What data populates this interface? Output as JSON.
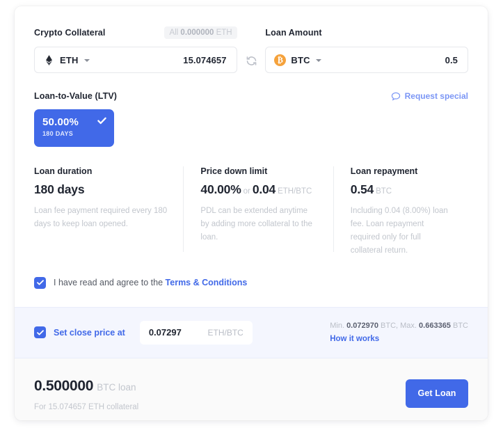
{
  "collateral": {
    "label": "Crypto Collateral",
    "all_prefix": "All",
    "all_amount": "0.000000",
    "all_unit": "ETH",
    "token": "ETH",
    "token_icon": "eth-diamond-icon",
    "amount": "15.074657"
  },
  "swap": {
    "icon": "swap-refresh-icon"
  },
  "loan_amount": {
    "label": "Loan Amount",
    "token": "BTC",
    "token_icon": "btc-circle-icon",
    "amount": "0.5"
  },
  "ltv": {
    "label": "Loan-to-Value (LTV)",
    "request_special": "Request special",
    "request_icon": "speech-bubble-icon",
    "selected": {
      "percent": "50.00%",
      "term": "180 DAYS",
      "check_icon": "check-icon"
    },
    "accent_color": "#4169e8"
  },
  "info": [
    {
      "title": "Loan duration",
      "value": "180 days",
      "unit": "",
      "desc": "Loan fee payment required every 180 days to keep loan opened."
    },
    {
      "title": "Price down limit",
      "value": "40.00%",
      "or": "or",
      "value2": "0.04",
      "unit": "ETH/BTC",
      "desc": "PDL can be extended anytime by adding more collateral to the loan."
    },
    {
      "title": "Loan repayment",
      "value": "0.54",
      "unit": "BTC",
      "desc": "Including 0.04 (8.00%) loan fee. Loan repayment required only for full collateral return."
    }
  ],
  "terms": {
    "checked": true,
    "text": "I have read and agree to the ",
    "link": "Terms & Conditions"
  },
  "close_price": {
    "checked": true,
    "label": "Set close price at",
    "value": "0.07297",
    "unit": "ETH/BTC",
    "min_prefix": "Min.",
    "min_value": "0.072970",
    "min_unit": "BTC,",
    "max_prefix": "Max.",
    "max_value": "0.663365",
    "max_unit": "BTC",
    "how_it_works": "How it works"
  },
  "footer": {
    "total": "0.500000",
    "total_unit": "BTC loan",
    "sub": "For 15.074657 ETH collateral",
    "cta": "Get Loan"
  }
}
